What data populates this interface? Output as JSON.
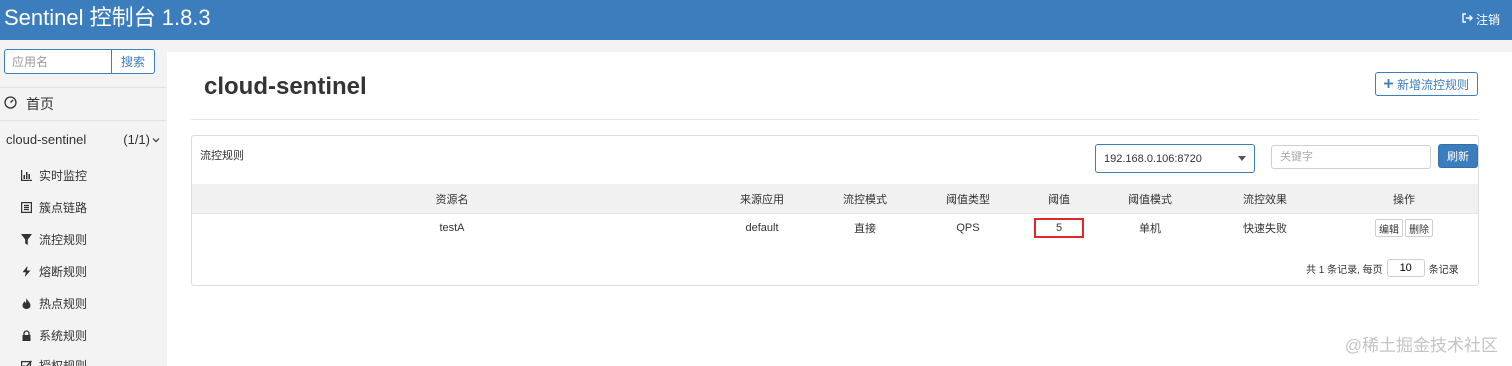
{
  "app": {
    "brand": "Sentinel 控制台 1.8.3",
    "logout_label": "注销"
  },
  "sidebar": {
    "search_placeholder": "应用名",
    "search_button": "搜索",
    "home_label": "首页",
    "app_name": "cloud-sentinel",
    "app_count": "(1/1)",
    "items": [
      {
        "label": "实时监控",
        "icon": "bar-chart-icon"
      },
      {
        "label": "簇点链路",
        "icon": "list-icon"
      },
      {
        "label": "流控规则",
        "icon": "filter-icon"
      },
      {
        "label": "熔断规则",
        "icon": "flash-icon"
      },
      {
        "label": "热点规则",
        "icon": "fire-icon"
      },
      {
        "label": "系统规则",
        "icon": "lock-icon"
      },
      {
        "label": "授权规则",
        "icon": "check-icon"
      }
    ]
  },
  "main": {
    "title": "cloud-sentinel",
    "add_button": "新增流控规则",
    "panel_title": "流控规则",
    "machine_selected": "192.168.0.106:8720",
    "keyword_placeholder": "关键字",
    "refresh_button": "刷新",
    "columns": [
      "资源名",
      "来源应用",
      "流控模式",
      "阈值类型",
      "阈值",
      "阈值模式",
      "流控效果",
      "操作"
    ],
    "rows": [
      {
        "resource": "testA",
        "limit_app": "default",
        "strategy": "直接",
        "grade": "QPS",
        "count": "5",
        "cluster_mode": "单机",
        "control_behavior": "快速失败",
        "edit": "编辑",
        "delete": "删除"
      }
    ],
    "pager": {
      "prefix": "共 1 条记录, 每页",
      "page_size": "10",
      "suffix": "条记录"
    }
  },
  "watermark": "@稀土掘金技术社区",
  "colors": {
    "primary": "#3c7dbd",
    "highlight": "#e02828"
  }
}
